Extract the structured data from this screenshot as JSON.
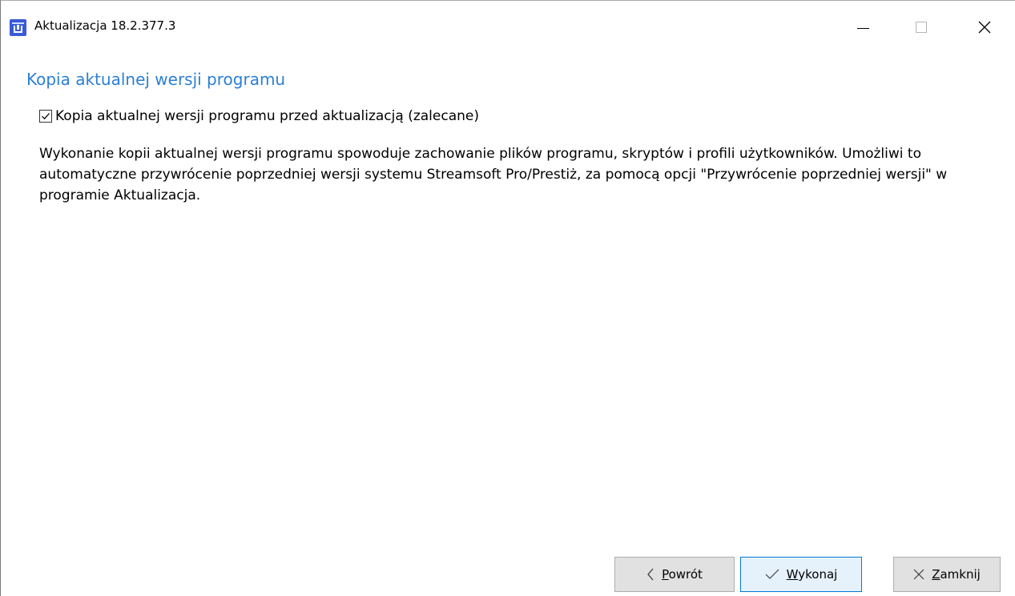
{
  "window": {
    "title": "Aktualizacja 18.2.377.3",
    "icon": "update-package-icon",
    "accent": "#3a5bd6"
  },
  "main": {
    "section_title": "Kopia aktualnej wersji programu",
    "section_title_color": "#2b7fd4",
    "backup_checkbox": {
      "label": "Kopia aktualnej wersji programu przed aktualizacją (zalecane)",
      "checked": true
    },
    "description": "Wykonanie kopii aktualnej wersji programu spowoduje zachowanie plików programu, skryptów i profili użytkowników. Umożliwi to automatyczne przywrócenie poprzedniej wersji systemu Streamsoft Pro/Prestiż, za pomocą opcji \"Przywrócenie poprzedniej wersji\" w programie Aktualizacja."
  },
  "buttons": {
    "back": {
      "mnemonic": "P",
      "rest": "owrót",
      "icon": "chevron-left-icon"
    },
    "execute": {
      "mnemonic": "W",
      "rest": "ykonaj",
      "icon": "checkmark-icon"
    },
    "close": {
      "mnemonic": "Z",
      "rest": "amknij",
      "icon": "close-icon"
    }
  }
}
